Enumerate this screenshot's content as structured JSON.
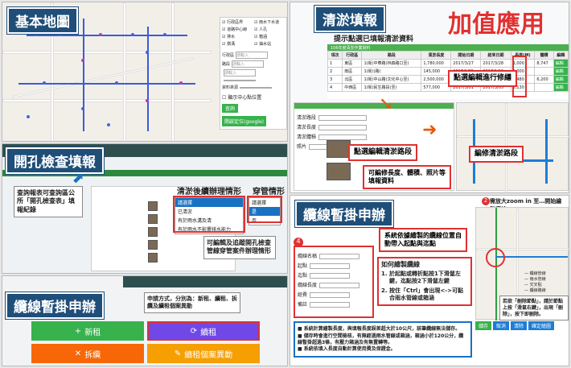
{
  "p1": {
    "title": "基本地圖",
    "layer_options": [
      "行政區界",
      "雨水下水道",
      "道路中心線",
      "人孔",
      "排水",
      "箱涵",
      "側溝",
      "抽水站"
    ],
    "form_labels": [
      "行政區",
      "路段",
      "",
      "",
      "資料來源"
    ],
    "input_placeholders": [
      "請輸入",
      "請輸入",
      "請輸入"
    ],
    "checkbox_label": "顯示中心點位置",
    "btn_search": "查詢",
    "btn_google": "開啟定位(google)"
  },
  "p2": {
    "title": "清淤填報",
    "subtitle": "提示點選已填報清淤資料",
    "table_header_bar": "106年度清淤作業資料",
    "headers": [
      "項次",
      "行政區",
      "路段",
      "清淤長度",
      "開始日期",
      "結束日期",
      "長度(M)",
      "體積",
      "編輯"
    ],
    "rows": [
      [
        "1",
        "東區",
        "1(街)中華路(林森路口至)",
        "1,780,000",
        "2017/3/27",
        "2017/3/28",
        "1,000",
        "8,747",
        "編輯"
      ],
      [
        "2",
        "南區",
        "1(街)(路)",
        "145,000",
        "2017/1/05",
        "2017/1/10",
        "1,000",
        "",
        "編輯"
      ],
      [
        "3",
        "北區",
        "1(街)中山路(文化中心至)",
        "2,500,000",
        "2017/4/10",
        "2017/4/15",
        "1,480",
        "6,200",
        "編輯"
      ],
      [
        "4",
        "中西區",
        "1(街)民生路段(至)",
        "577,000",
        "2017/3/01",
        "2017/3/05",
        "2,130",
        "",
        "編輯"
      ]
    ],
    "callout_edit": "點選編輯進行修繕",
    "callout_segment": "點選編輯清淤路段",
    "callout_modify": "可編修長度、體積、照片等填報資料",
    "callout_route": "編修清淤路段",
    "tag_value_added": "加值應用",
    "form_labels": [
      "清淤路段",
      "清淤長度",
      "清淤體積",
      "照片"
    ]
  },
  "p3": {
    "title": "開孔檢查填報",
    "callout_query": "查詢報表可查詢區公所「開孔檢查表」填報紀錄",
    "label_follow": "清淤後續辦理情形",
    "label_pipe": "穿管情形",
    "dropdown_selected": "請選擇",
    "dropdown_options": [
      "請選擇",
      "已清淤",
      "有於雨水溝及清",
      "有於雨水不影響排水能力"
    ],
    "pipe_options": [
      "請選擇",
      "是",
      "否"
    ],
    "callout_edit": "可編輯及追蹤開孔檢查管線穿管案件辦理情形"
  },
  "p4": {
    "title": "纜線暫掛申辦",
    "apply_note": "申請方式，分別為：新租、續租、拆纜及續租個案異動",
    "btn_new": "新租",
    "btn_renew": "續租",
    "btn_remove": "拆纜",
    "btn_change": "續租個案異動"
  },
  "p5": {
    "title": "纜線暫掛申辦",
    "callout_auto": "系統依據繪製的纜線位置自動帶入起點與迄點",
    "badge_num": "4",
    "badge_num2": "2",
    "howto_title": "如何繪製纜線",
    "howto_items": [
      "於起點或轉折點按1下滑鼠左鍵，迄點按2下滑鼠左鍵",
      "按住「Ctrl」會出現<->可黏合雨水管線或箱涵"
    ],
    "zoom_note": "需放大zoom in 至…開始繪製纜線",
    "delete_note": "若欲「刪除節點」，請於節點上按「滑鼠右鍵」，出現「刪除」，按下即刪除。",
    "form_labels": [
      "纜線名稱",
      "起點",
      "迄點",
      "纜線長度",
      "經費",
      "備註"
    ],
    "bullets": [
      "系統計算繪製長度，與填報長度誤差超大於10公尺，該筆纜線無法儲存。",
      "儲存時會進行空間檢核，有無經過雨水管線或箱涵，箱涵小於120公分，纜線暫掛超過3條，有壓力箱涵及有無置轉等。",
      "系統依填入長度自動計算使用費及保證金。"
    ],
    "legend": [
      "纜線管線",
      "雨水管線",
      "交叉點",
      "纜線路線"
    ],
    "btn_save": "儲存",
    "btn_cancel": "取消",
    "btn_clear": "清除",
    "btn_confirm": "確定繪圖"
  },
  "colors": {
    "title_bg": "#1f4e79",
    "accent_red": "#e03131",
    "green_bar": "#4caf50",
    "btn_green": "#37b24d",
    "btn_purple": "#7048e8",
    "btn_orange": "#f76707",
    "btn_yellow": "#f59f00"
  }
}
